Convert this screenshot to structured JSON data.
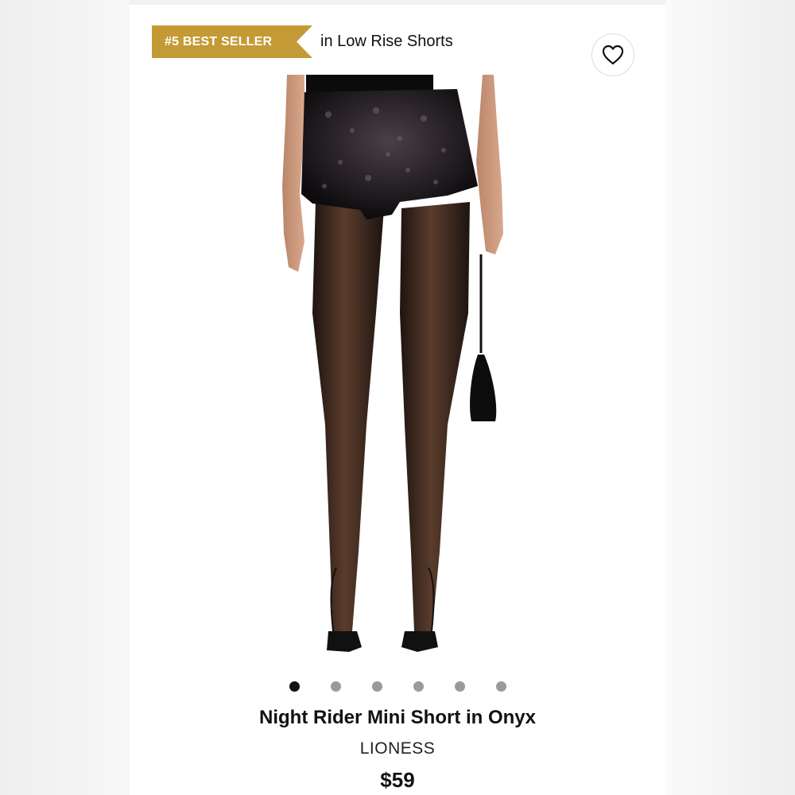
{
  "badge": {
    "label": "#5 BEST SELLER",
    "context": "in Low Rise Shorts",
    "color": "#c49a36"
  },
  "wishlist": {
    "icon": "heart-icon"
  },
  "product": {
    "image_alt": "Night Rider Mini Short in Onyx",
    "title": "Night Rider Mini Short in Onyx",
    "brand": "LIONESS",
    "price": "$59"
  },
  "carousel": {
    "count": 6,
    "active_index": 0
  }
}
